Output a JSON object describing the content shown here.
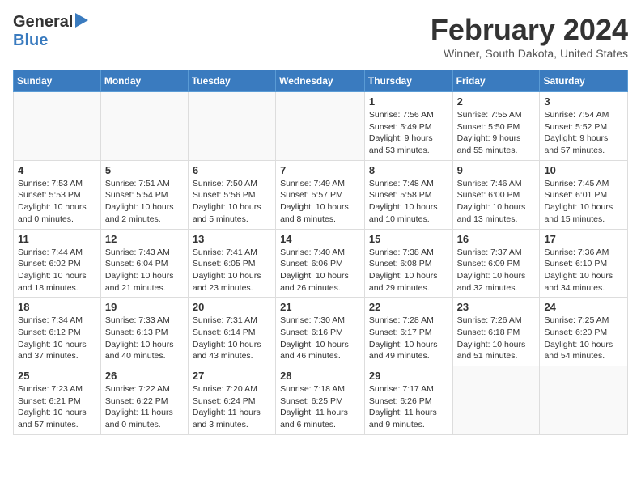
{
  "header": {
    "logo_general": "General",
    "logo_blue": "Blue",
    "title": "February 2024",
    "location": "Winner, South Dakota, United States"
  },
  "weekdays": [
    "Sunday",
    "Monday",
    "Tuesday",
    "Wednesday",
    "Thursday",
    "Friday",
    "Saturday"
  ],
  "weeks": [
    [
      {
        "day": "",
        "info": ""
      },
      {
        "day": "",
        "info": ""
      },
      {
        "day": "",
        "info": ""
      },
      {
        "day": "",
        "info": ""
      },
      {
        "day": "1",
        "info": "Sunrise: 7:56 AM\nSunset: 5:49 PM\nDaylight: 9 hours\nand 53 minutes."
      },
      {
        "day": "2",
        "info": "Sunrise: 7:55 AM\nSunset: 5:50 PM\nDaylight: 9 hours\nand 55 minutes."
      },
      {
        "day": "3",
        "info": "Sunrise: 7:54 AM\nSunset: 5:52 PM\nDaylight: 9 hours\nand 57 minutes."
      }
    ],
    [
      {
        "day": "4",
        "info": "Sunrise: 7:53 AM\nSunset: 5:53 PM\nDaylight: 10 hours\nand 0 minutes."
      },
      {
        "day": "5",
        "info": "Sunrise: 7:51 AM\nSunset: 5:54 PM\nDaylight: 10 hours\nand 2 minutes."
      },
      {
        "day": "6",
        "info": "Sunrise: 7:50 AM\nSunset: 5:56 PM\nDaylight: 10 hours\nand 5 minutes."
      },
      {
        "day": "7",
        "info": "Sunrise: 7:49 AM\nSunset: 5:57 PM\nDaylight: 10 hours\nand 8 minutes."
      },
      {
        "day": "8",
        "info": "Sunrise: 7:48 AM\nSunset: 5:58 PM\nDaylight: 10 hours\nand 10 minutes."
      },
      {
        "day": "9",
        "info": "Sunrise: 7:46 AM\nSunset: 6:00 PM\nDaylight: 10 hours\nand 13 minutes."
      },
      {
        "day": "10",
        "info": "Sunrise: 7:45 AM\nSunset: 6:01 PM\nDaylight: 10 hours\nand 15 minutes."
      }
    ],
    [
      {
        "day": "11",
        "info": "Sunrise: 7:44 AM\nSunset: 6:02 PM\nDaylight: 10 hours\nand 18 minutes."
      },
      {
        "day": "12",
        "info": "Sunrise: 7:43 AM\nSunset: 6:04 PM\nDaylight: 10 hours\nand 21 minutes."
      },
      {
        "day": "13",
        "info": "Sunrise: 7:41 AM\nSunset: 6:05 PM\nDaylight: 10 hours\nand 23 minutes."
      },
      {
        "day": "14",
        "info": "Sunrise: 7:40 AM\nSunset: 6:06 PM\nDaylight: 10 hours\nand 26 minutes."
      },
      {
        "day": "15",
        "info": "Sunrise: 7:38 AM\nSunset: 6:08 PM\nDaylight: 10 hours\nand 29 minutes."
      },
      {
        "day": "16",
        "info": "Sunrise: 7:37 AM\nSunset: 6:09 PM\nDaylight: 10 hours\nand 32 minutes."
      },
      {
        "day": "17",
        "info": "Sunrise: 7:36 AM\nSunset: 6:10 PM\nDaylight: 10 hours\nand 34 minutes."
      }
    ],
    [
      {
        "day": "18",
        "info": "Sunrise: 7:34 AM\nSunset: 6:12 PM\nDaylight: 10 hours\nand 37 minutes."
      },
      {
        "day": "19",
        "info": "Sunrise: 7:33 AM\nSunset: 6:13 PM\nDaylight: 10 hours\nand 40 minutes."
      },
      {
        "day": "20",
        "info": "Sunrise: 7:31 AM\nSunset: 6:14 PM\nDaylight: 10 hours\nand 43 minutes."
      },
      {
        "day": "21",
        "info": "Sunrise: 7:30 AM\nSunset: 6:16 PM\nDaylight: 10 hours\nand 46 minutes."
      },
      {
        "day": "22",
        "info": "Sunrise: 7:28 AM\nSunset: 6:17 PM\nDaylight: 10 hours\nand 49 minutes."
      },
      {
        "day": "23",
        "info": "Sunrise: 7:26 AM\nSunset: 6:18 PM\nDaylight: 10 hours\nand 51 minutes."
      },
      {
        "day": "24",
        "info": "Sunrise: 7:25 AM\nSunset: 6:20 PM\nDaylight: 10 hours\nand 54 minutes."
      }
    ],
    [
      {
        "day": "25",
        "info": "Sunrise: 7:23 AM\nSunset: 6:21 PM\nDaylight: 10 hours\nand 57 minutes."
      },
      {
        "day": "26",
        "info": "Sunrise: 7:22 AM\nSunset: 6:22 PM\nDaylight: 11 hours\nand 0 minutes."
      },
      {
        "day": "27",
        "info": "Sunrise: 7:20 AM\nSunset: 6:24 PM\nDaylight: 11 hours\nand 3 minutes."
      },
      {
        "day": "28",
        "info": "Sunrise: 7:18 AM\nSunset: 6:25 PM\nDaylight: 11 hours\nand 6 minutes."
      },
      {
        "day": "29",
        "info": "Sunrise: 7:17 AM\nSunset: 6:26 PM\nDaylight: 11 hours\nand 9 minutes."
      },
      {
        "day": "",
        "info": ""
      },
      {
        "day": "",
        "info": ""
      }
    ]
  ]
}
